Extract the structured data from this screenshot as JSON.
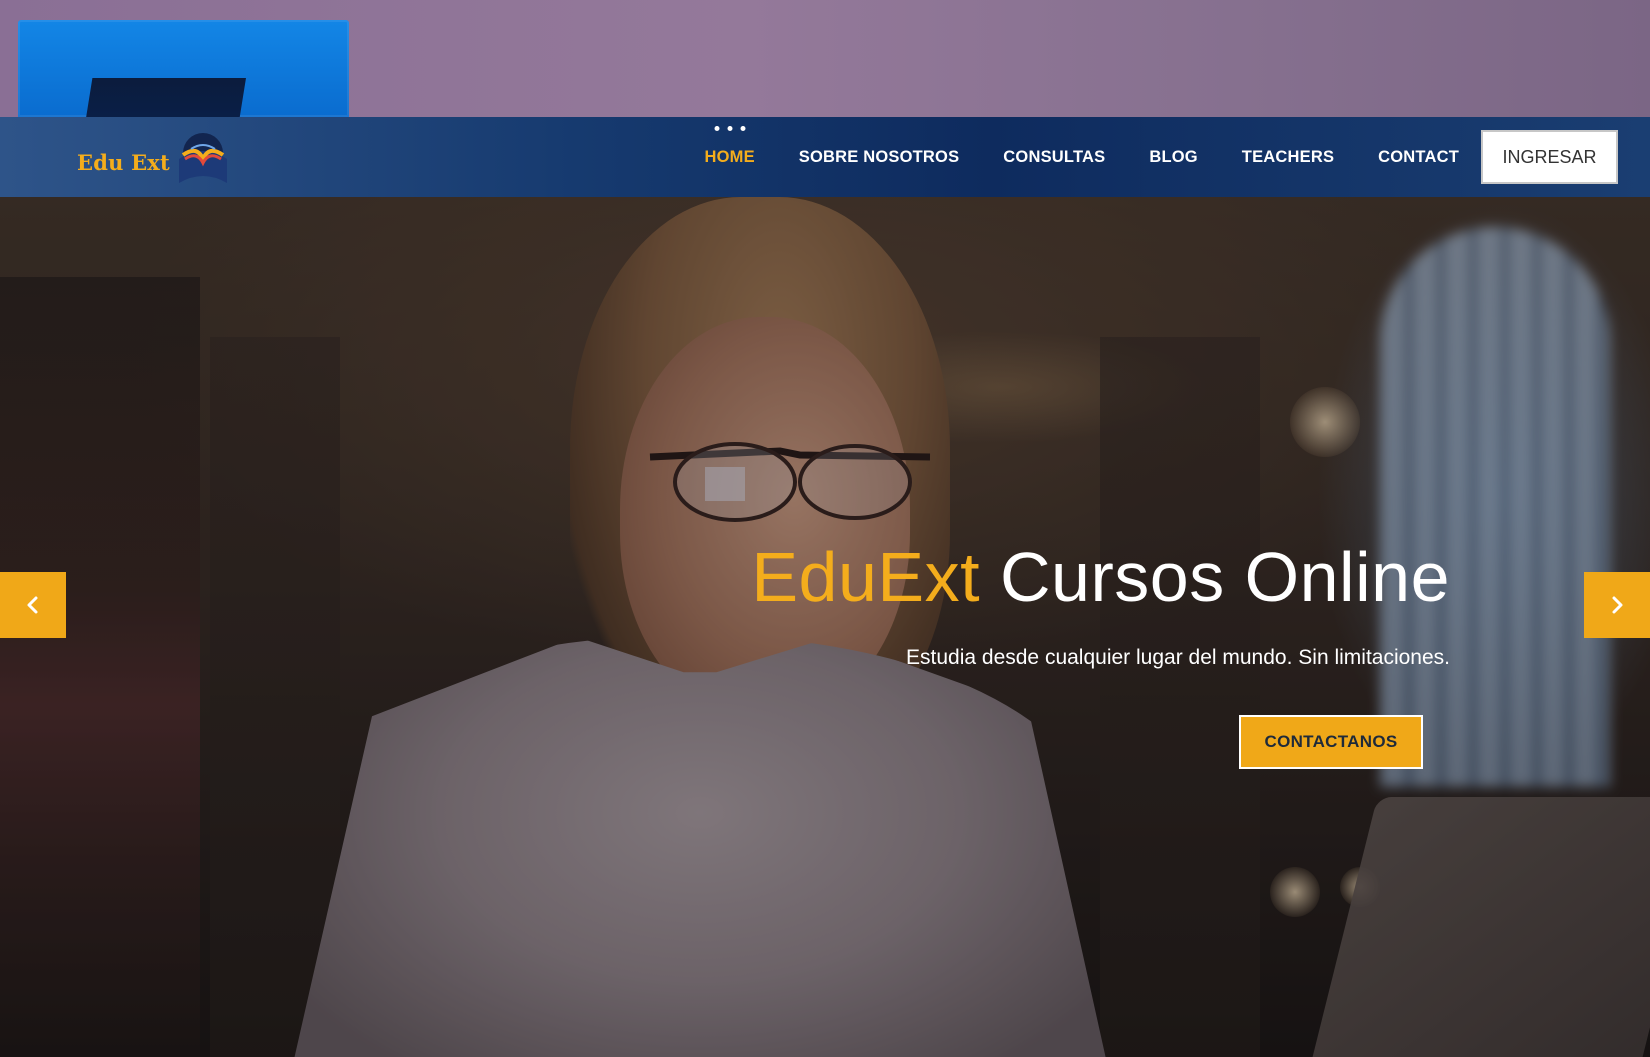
{
  "nav": {
    "logo_text": "Edu Ext",
    "items": [
      {
        "label": "HOME",
        "active": true
      },
      {
        "label": "SOBRE NOSOTROS",
        "active": false
      },
      {
        "label": "CONSULTAS",
        "active": false
      },
      {
        "label": "BLOG",
        "active": false
      },
      {
        "label": "TEACHERS",
        "active": false
      },
      {
        "label": "CONTACT",
        "active": false
      }
    ],
    "login_label": "INGRESAR"
  },
  "hero": {
    "title_brand": "EduExt",
    "title_rest": " Cursos Online",
    "subtitle": "Estudia desde cualquier lugar del mundo. Sin limitaciones.",
    "cta_label": "CONTACTANOS"
  },
  "carousel": {
    "prev_icon": "chevron-left-icon",
    "next_icon": "chevron-right-icon"
  },
  "colors": {
    "accent": "#f4ad1c",
    "nav_bg": "#0e2b5e",
    "text_light": "#ffffff"
  }
}
